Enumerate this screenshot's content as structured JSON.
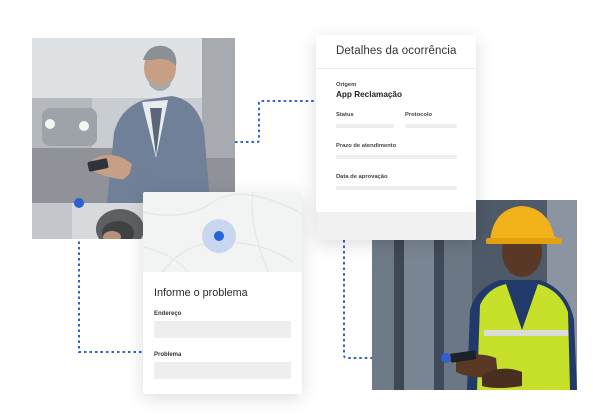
{
  "details_card": {
    "title": "Detalhes da ocorrência",
    "origin_label": "Origem",
    "origin_value": "App Reclamação",
    "status_label": "Status",
    "protocol_label": "Protocolo",
    "deadline_label": "Prazo de atendimento",
    "approval_label": "Data de aprovação"
  },
  "form_card": {
    "title": "Informe o problema",
    "address_label": "Endereço",
    "address_value": "",
    "problem_label": "Problema",
    "problem_value": ""
  },
  "colors": {
    "accent": "#2f5fd0",
    "pin": "#2563d6",
    "pin_halo": "#c9d6f0",
    "placeholder_bar": "#eeeeee"
  },
  "icons": {
    "map_pin": "map-pin-icon"
  }
}
